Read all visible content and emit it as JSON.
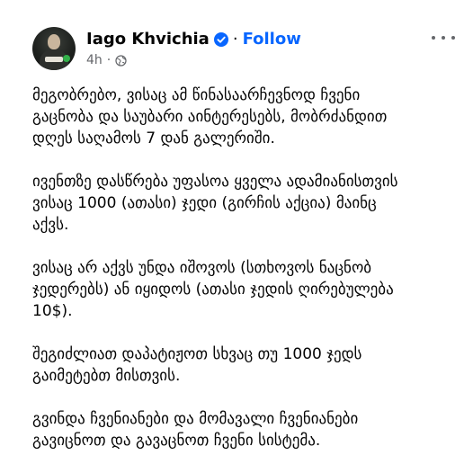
{
  "post": {
    "author": "Iago Khvichia",
    "separator": "·",
    "follow_label": "Follow",
    "time": "4h",
    "meta_separator": "·",
    "audience_icon": "globe-icon",
    "verified_icon": "verified-badge-icon",
    "more_icon": "more-options-icon",
    "paragraphs": [
      "მეგობრებო, ვისაც ამ წინასაარჩევნოდ ჩვენი\nგაცნობა და  საუბარი აინტერესებს, მობრძანდით\nდღეს საღამოს 7 დან გალერიში.",
      "ივენთზე დასწრება უფასოა ყველა ადამიანისთვის\nვისაც 1000 (ათასი) ჯედი (გირჩის აქცია) მაინც\nაქვს.",
      "ვისაც არ აქვს უნდა იშოვოს (სთხოვოს ნაცნობ\nჯედერებს) ან იყიდოს (ათასი ჯედის ღირებულება\n10$).",
      "შეგიძლიათ დაპატიჟოთ სხვაც თუ 1000 ჯედს\nგაიმეტებთ მისთვის.",
      "გვინდა ჩვენიანები და მომავალი ჩვენიანები\nგავიცნოთ და გავაცნოთ ჩვენი სისტემა."
    ]
  },
  "colors": {
    "accent": "#0866ff",
    "text": "#050505",
    "secondary": "#65676b"
  }
}
